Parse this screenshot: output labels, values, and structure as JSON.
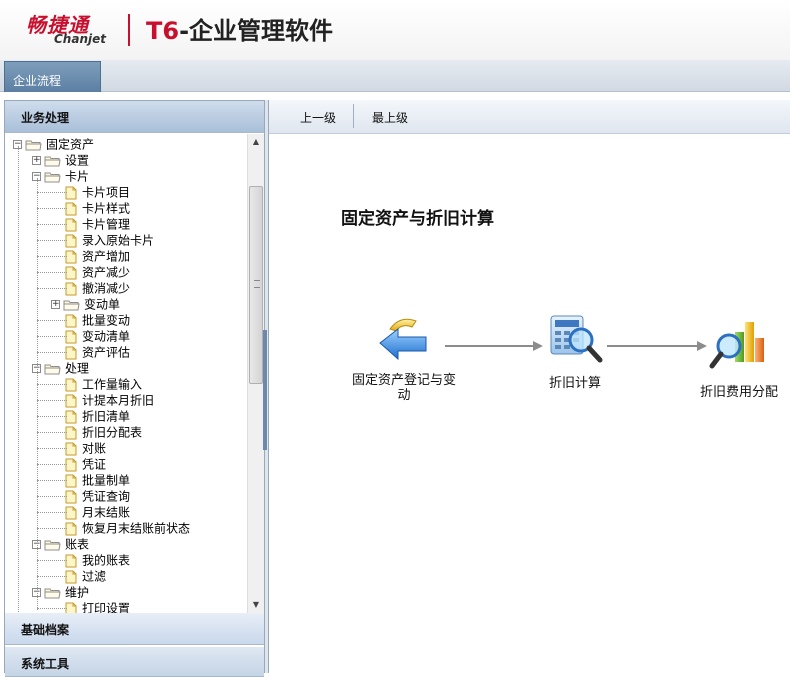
{
  "header": {
    "brand_cn": "畅捷通",
    "brand_en": "Chanjet",
    "product_prefix": "T6",
    "product_suffix": "-企业管理软件"
  },
  "tabs": [
    {
      "label": "企业流程"
    }
  ],
  "left_panel": {
    "sections": [
      {
        "label": "业务处理"
      },
      {
        "label": "基础档案"
      },
      {
        "label": "系统工具"
      }
    ],
    "tree": [
      {
        "label": "固定资产",
        "type": "folder",
        "expander": "−",
        "level": 0
      },
      {
        "label": "设置",
        "type": "folder",
        "expander": "+",
        "level": 1
      },
      {
        "label": "卡片",
        "type": "folder",
        "expander": "−",
        "level": 1
      },
      {
        "label": "卡片项目",
        "type": "doc",
        "level": 2
      },
      {
        "label": "卡片样式",
        "type": "doc",
        "level": 2
      },
      {
        "label": "卡片管理",
        "type": "doc",
        "level": 2
      },
      {
        "label": "录入原始卡片",
        "type": "doc",
        "level": 2
      },
      {
        "label": "资产增加",
        "type": "doc",
        "level": 2
      },
      {
        "label": "资产减少",
        "type": "doc",
        "level": 2
      },
      {
        "label": "撤消减少",
        "type": "doc",
        "level": 2
      },
      {
        "label": "变动单",
        "type": "folder",
        "expander": "+",
        "level": 2
      },
      {
        "label": "批量变动",
        "type": "doc",
        "level": 2
      },
      {
        "label": "变动清单",
        "type": "doc",
        "level": 2
      },
      {
        "label": "资产评估",
        "type": "doc",
        "level": 2
      },
      {
        "label": "处理",
        "type": "folder",
        "expander": "−",
        "level": 1
      },
      {
        "label": "工作量输入",
        "type": "doc",
        "level": 2
      },
      {
        "label": "计提本月折旧",
        "type": "doc",
        "level": 2
      },
      {
        "label": "折旧清单",
        "type": "doc",
        "level": 2
      },
      {
        "label": "折旧分配表",
        "type": "doc",
        "level": 2
      },
      {
        "label": "对账",
        "type": "doc",
        "level": 2
      },
      {
        "label": "凭证",
        "type": "doc",
        "level": 2
      },
      {
        "label": "批量制单",
        "type": "doc",
        "level": 2
      },
      {
        "label": "凭证查询",
        "type": "doc",
        "level": 2
      },
      {
        "label": "月末结账",
        "type": "doc",
        "level": 2
      },
      {
        "label": "恢复月末结账前状态",
        "type": "doc",
        "level": 2
      },
      {
        "label": "账表",
        "type": "folder",
        "expander": "−",
        "level": 1
      },
      {
        "label": "我的账表",
        "type": "doc",
        "level": 2
      },
      {
        "label": "过滤",
        "type": "doc",
        "level": 2
      },
      {
        "label": "维护",
        "type": "folder",
        "expander": "−",
        "level": 1
      },
      {
        "label": "打印设置",
        "type": "doc",
        "level": 2
      }
    ]
  },
  "toolbar": {
    "up_label": "上一级",
    "top_label": "最上级"
  },
  "flow": {
    "title": "固定资产与折旧计算",
    "nodes": [
      {
        "label_line1": "固定资产登记与变",
        "label_line2": "动",
        "icon": "back-arrow-icon"
      },
      {
        "label_line1": "折旧计算",
        "label_line2": "",
        "icon": "calculator-magnifier-icon"
      },
      {
        "label_line1": "折旧费用分配",
        "label_line2": "",
        "icon": "chart-magnifier-icon"
      }
    ]
  },
  "colors": {
    "brand_red": "#c8102e",
    "tab_blue": "#5b7fa3",
    "arrow_gray": "#8c8c8c"
  }
}
